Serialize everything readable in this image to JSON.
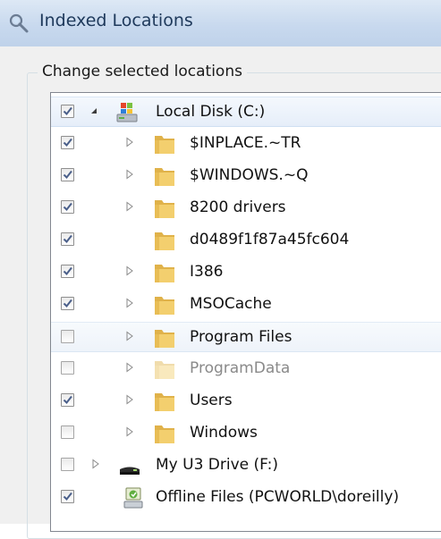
{
  "window": {
    "title": "Indexed Locations"
  },
  "group": {
    "label": "Change selected locations"
  },
  "tree": {
    "items": [
      {
        "label": "Local Disk (C:)",
        "checked": true,
        "icon": "drive-icon",
        "expander": "expanded"
      },
      {
        "label": "$INPLACE.~TR",
        "checked": true,
        "icon": "folder-icon",
        "expander": "collapsed"
      },
      {
        "label": "$WINDOWS.~Q",
        "checked": true,
        "icon": "folder-icon",
        "expander": "collapsed"
      },
      {
        "label": "8200 drivers",
        "checked": true,
        "icon": "folder-icon",
        "expander": "collapsed"
      },
      {
        "label": "d0489f1f87a45fc604",
        "checked": true,
        "icon": "folder-icon",
        "expander": "none"
      },
      {
        "label": "I386",
        "checked": true,
        "icon": "folder-icon",
        "expander": "collapsed"
      },
      {
        "label": "MSOCache",
        "checked": true,
        "icon": "folder-icon",
        "expander": "collapsed"
      },
      {
        "label": "Program Files",
        "checked": false,
        "icon": "folder-icon",
        "expander": "collapsed"
      },
      {
        "label": "ProgramData",
        "checked": false,
        "icon": "folder-icon-faded",
        "expander": "collapsed"
      },
      {
        "label": "Users",
        "checked": true,
        "icon": "folder-icon",
        "expander": "collapsed"
      },
      {
        "label": "Windows",
        "checked": false,
        "icon": "folder-icon",
        "expander": "collapsed"
      },
      {
        "label": "My U3 Drive (F:)",
        "checked": false,
        "icon": "usb-drive-icon",
        "expander": "collapsed"
      },
      {
        "label": "Offline Files (PCWORLD\\doreilly)",
        "checked": true,
        "icon": "offline-files-icon",
        "expander": "none"
      }
    ]
  },
  "colors": {
    "checkmark": "#4a5f8a",
    "folder": "#f2c75a",
    "titlebar": "#c8d9ee"
  }
}
